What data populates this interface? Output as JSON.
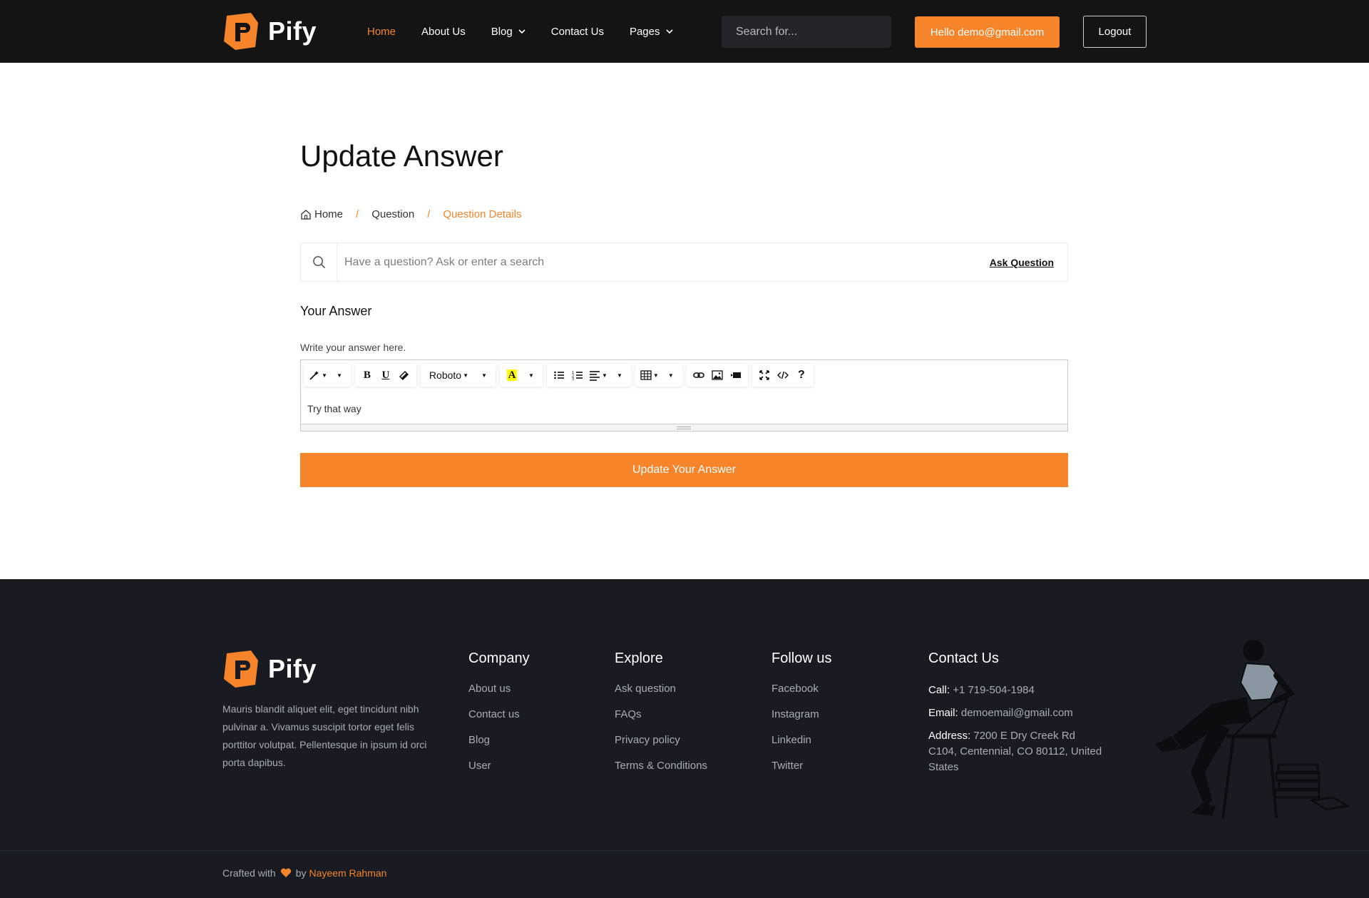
{
  "brand": {
    "name": "Pify"
  },
  "nav": {
    "items": [
      {
        "label": "Home",
        "active": true
      },
      {
        "label": "About Us",
        "active": false
      },
      {
        "label": "Blog",
        "dropdown": true
      },
      {
        "label": "Contact Us",
        "active": false
      },
      {
        "label": "Pages",
        "dropdown": true
      }
    ],
    "search_placeholder": "Search for...",
    "greeting_button": "Hello demo@gmail.com",
    "logout_button": "Logout"
  },
  "page": {
    "title": "Update Answer",
    "breadcrumb": {
      "home": "Home",
      "middle": "Question",
      "current": "Question Details",
      "separator": "/"
    },
    "question_search": {
      "placeholder": "Have a question? Ask or enter a search",
      "ask_link": "Ask Question"
    },
    "answer_heading": "Your Answer",
    "answer_hint": "Write your answer here.",
    "editor": {
      "font": "Roboto",
      "content": "Try that way"
    },
    "submit_button": "Update Your Answer"
  },
  "footer": {
    "about": "Mauris blandit aliquet elit, eget tincidunt nibh pulvinar a. Vivamus suscipit tortor eget felis porttitor volutpat. Pellentesque in ipsum id orci porta dapibus.",
    "company": {
      "title": "Company",
      "links": [
        "About us",
        "Contact us",
        "Blog",
        "User"
      ]
    },
    "explore": {
      "title": "Explore",
      "links": [
        "Ask question",
        "FAQs",
        "Privacy policy",
        "Terms & Conditions"
      ]
    },
    "follow": {
      "title": "Follow us",
      "links": [
        "Facebook",
        "Instagram",
        "Linkedin",
        "Twitter"
      ]
    },
    "contact": {
      "title": "Contact Us",
      "call_label": "Call:",
      "call": "+1 719-504-1984",
      "email_label": "Email:",
      "email": "demoemail@gmail.com",
      "address_label": "Address:",
      "address": "7200 E Dry Creek Rd C104, Centennial, CO 80112, United States"
    },
    "credit": {
      "prefix": "Crafted with",
      "by": "by",
      "author": "Nayeem Rahman"
    }
  },
  "colors": {
    "accent": "#f5842a",
    "nav_bg": "#141414",
    "footer_bg": "#181c22"
  }
}
